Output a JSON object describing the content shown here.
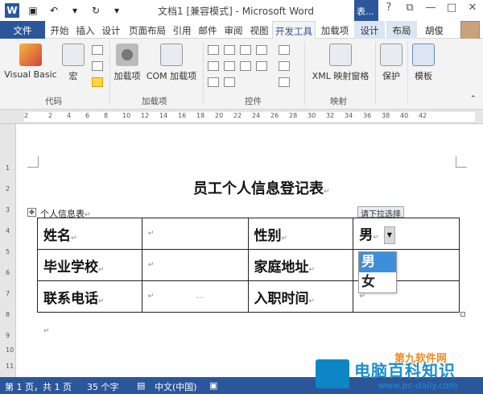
{
  "window": {
    "title": "文档1 [兼容模式] - Microsoft Word",
    "context_tab": "表...",
    "controls": [
      "?",
      "⧉",
      "—",
      "□",
      "✕"
    ]
  },
  "tabs": [
    {
      "label": "文件"
    },
    {
      "label": "开始"
    },
    {
      "label": "插入"
    },
    {
      "label": "设计"
    },
    {
      "label": "页面布局"
    },
    {
      "label": "引用"
    },
    {
      "label": "邮件"
    },
    {
      "label": "审阅"
    },
    {
      "label": "视图"
    },
    {
      "label": "开发工具"
    },
    {
      "label": "加载项"
    },
    {
      "label": "设计"
    },
    {
      "label": "布局"
    }
  ],
  "user": "胡俊",
  "ribbon": {
    "groups": [
      {
        "label": "代码",
        "buttons": [
          "Visual Basic",
          "宏"
        ]
      },
      {
        "label": "加载项",
        "buttons": [
          "加载项",
          "COM 加载项"
        ]
      },
      {
        "label": "控件"
      },
      {
        "label": "映射",
        "buttons": [
          "XML 映射窗格"
        ]
      },
      {
        "label": "",
        "buttons": [
          "保护",
          "模板"
        ]
      }
    ],
    "ruler_labels": [
      "2",
      "2",
      "4",
      "6",
      "8",
      "10",
      "12",
      "14",
      "16",
      "18",
      "20",
      "22",
      "24",
      "26",
      "28",
      "30",
      "32",
      "34",
      "36",
      "38",
      "40",
      "42"
    ],
    "vruler_labels": [
      "1",
      "2",
      "3",
      "4",
      "5",
      "6",
      "7",
      "8",
      "9",
      "10",
      "11"
    ]
  },
  "document": {
    "heading": "员工个人信息登记表",
    "caption": "个人信息表",
    "field_mark": "↵",
    "placeholder_dots": "...",
    "table": {
      "rows": [
        {
          "label1": "姓名",
          "label2": "性别",
          "value2": "男"
        },
        {
          "label1": "毕业学校",
          "label2": "家庭地址",
          "value2": ""
        },
        {
          "label1": "联系电话",
          "label2": "入职时间",
          "value2": ""
        }
      ]
    },
    "control_tip": "请下拉选择",
    "dropdown_options": [
      {
        "label": "男",
        "selected": true
      },
      {
        "label": "女",
        "selected": false
      }
    ]
  },
  "statusbar": {
    "page": "第 1 页，共 1 页",
    "words": "35 个字",
    "language": "中文(中国)"
  },
  "watermark": {
    "title": "电脑百科知识",
    "url": "www.pc-daily.com",
    "top": "第九软件网"
  },
  "colors": {
    "accent": "#2b579a",
    "dropdown_selected": "#3d8fdc",
    "watermark": "#1a8fd0"
  }
}
